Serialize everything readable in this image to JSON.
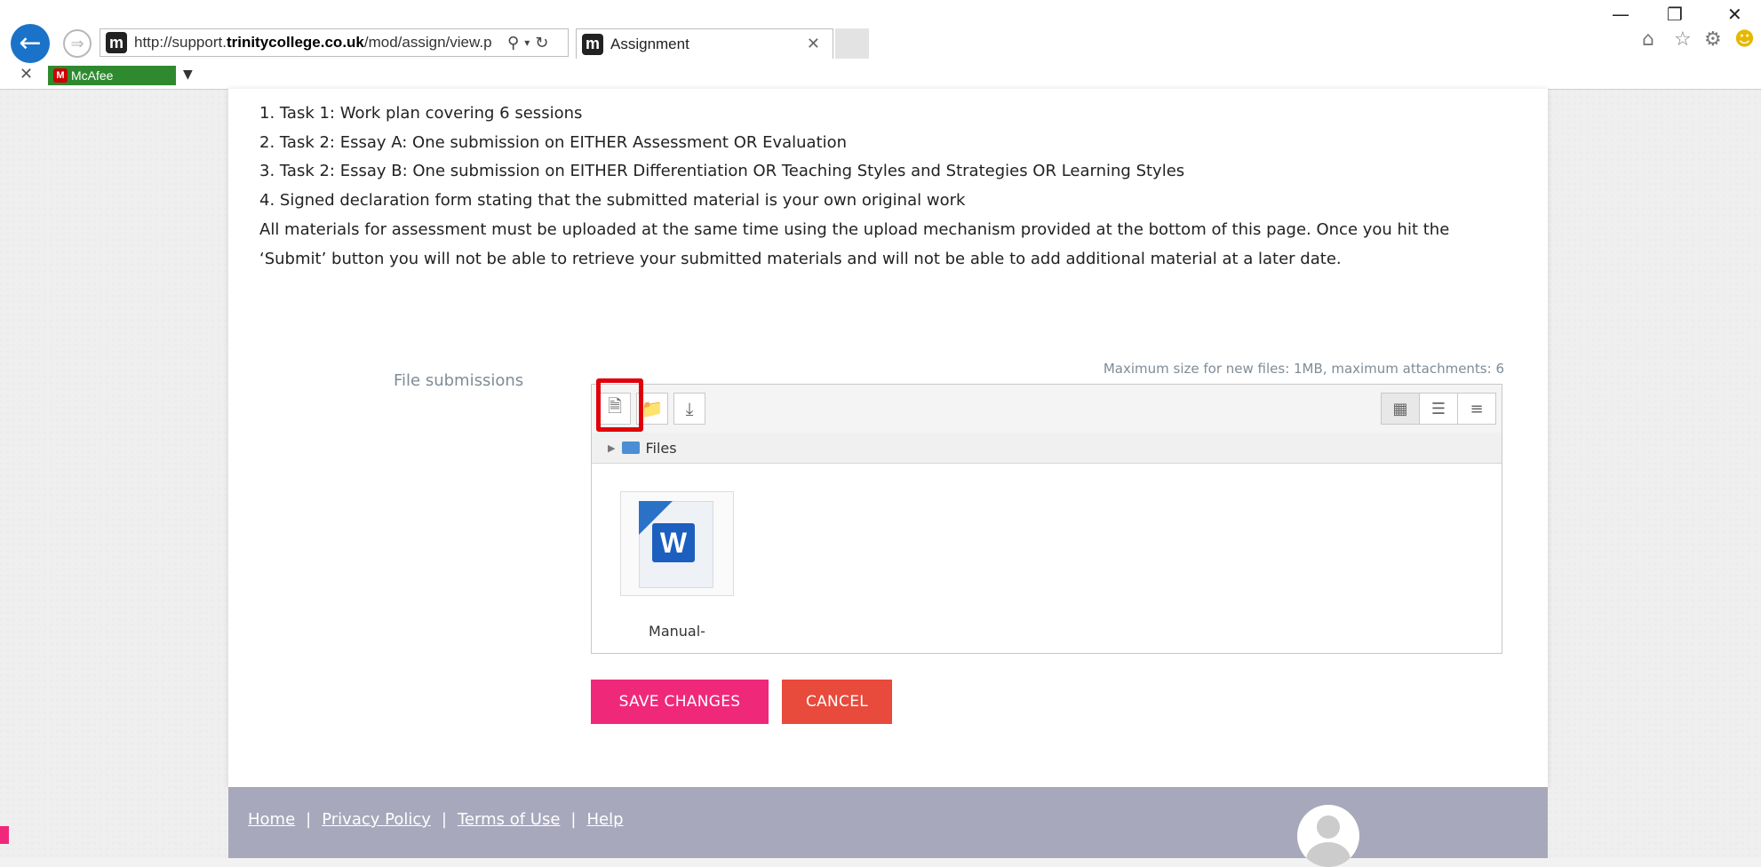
{
  "browser": {
    "url_prefix": "http://support.",
    "url_domain": "trinitycollege.co.uk",
    "url_path": "/mod/assign/view.p",
    "tab_title": "Assignment",
    "favicon_letter": "m",
    "addon_label": "McAfee"
  },
  "content": {
    "list": [
      "1. Task 1: Work plan covering 6 sessions",
      "2. Task 2: Essay A: One submission on EITHER Assessment OR Evaluation",
      "3. Task 2: Essay B: One submission on EITHER Differentiation OR Teaching Styles and Strategies OR Learning Styles",
      "4. Signed declaration form stating that the submitted material is your own original work"
    ],
    "paragraph": "All materials for assessment must be uploaded at the same time using the upload mechanism provided at the bottom of this page. Once you hit the ‘Submit’ button you will not be able to retrieve your submitted materials and will not be able to add additional material at a later date."
  },
  "submission": {
    "label": "File submissions",
    "max_info": "Maximum size for new files: 1MB, maximum attachments: 6",
    "path_label": "Files",
    "file_name": "Manual-",
    "save_label": "SAVE CHANGES",
    "cancel_label": "CANCEL"
  },
  "footer": {
    "links": [
      "Home",
      "Privacy Policy",
      "Terms of Use",
      "Help"
    ]
  },
  "colors": {
    "save": "#f0287a",
    "cancel": "#e84a3b",
    "highlight": "#e0000b",
    "footer": "#a8a8bc"
  },
  "icons": [
    "back-arrow-icon",
    "forward-arrow-icon",
    "search-icon",
    "refresh-icon",
    "home-icon",
    "star-icon",
    "gear-icon",
    "smiley-icon",
    "add-file-icon",
    "create-folder-icon",
    "download-icon",
    "grid-view-icon",
    "list-view-icon",
    "tree-view-icon",
    "folder-icon",
    "word-document-icon"
  ]
}
